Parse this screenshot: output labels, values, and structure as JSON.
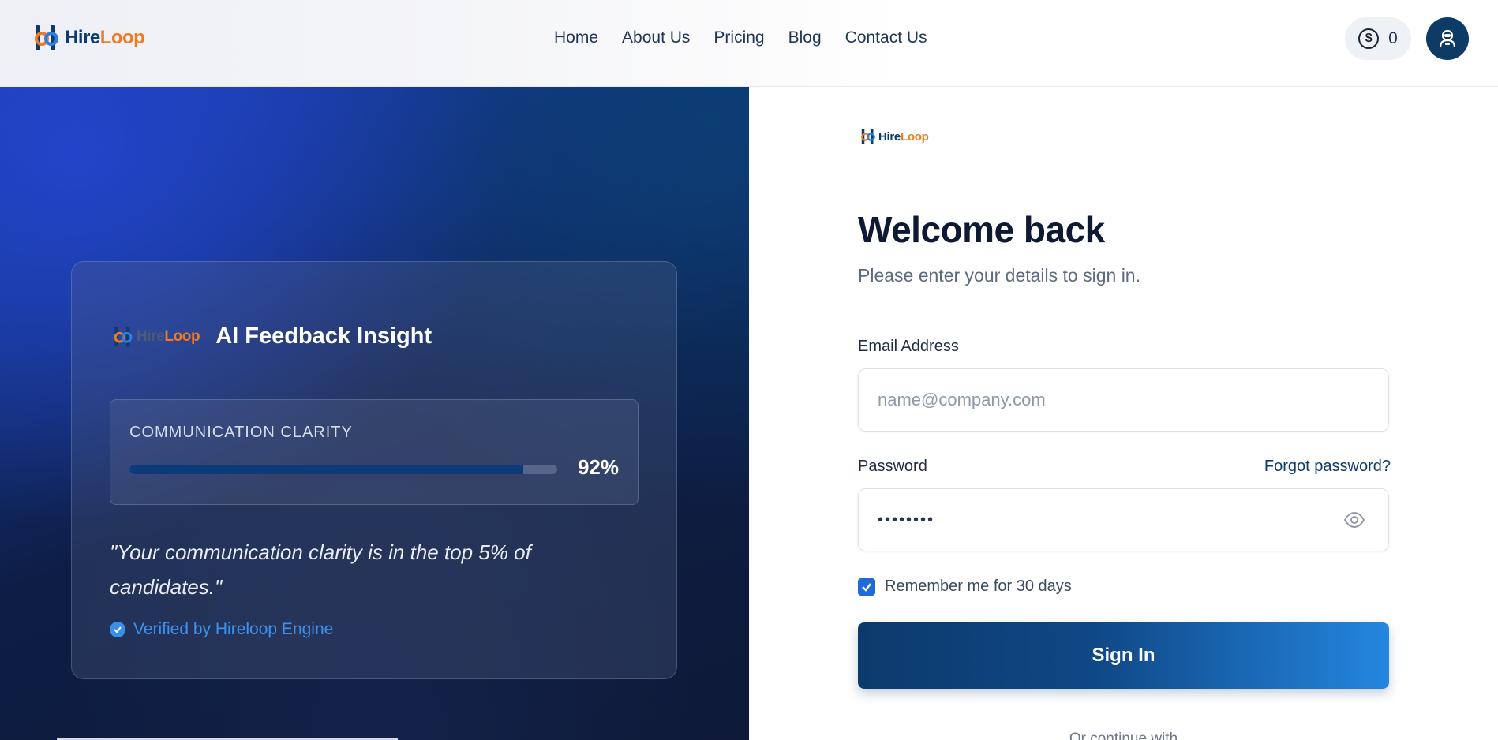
{
  "brand": {
    "hire": "Hire",
    "loop": "Loop",
    "accent_orange": "#ef7a20",
    "accent_navy": "#0e3b6e"
  },
  "nav": {
    "items": [
      "Home",
      "About Us",
      "Pricing",
      "Blog",
      "Contact Us"
    ]
  },
  "credits": {
    "icon": "dollar-coin-icon",
    "count": "0"
  },
  "profile": {
    "icon": "user-avatar-icon"
  },
  "insight": {
    "card_brand_hire": "Hire",
    "card_brand_loop": "Loop",
    "title": "AI Feedback Insight",
    "metric_label": "COMMUNICATION CLARITY",
    "metric_value": "92%",
    "metric_fraction": 0.92,
    "quote": "\"Your communication clarity is in the top 5% of candidates.\"",
    "verified": "Verified by Hireloop Engine"
  },
  "form": {
    "logo_hire": "Hire",
    "logo_loop": "Loop",
    "heading": "Welcome back",
    "subtitle": "Please enter your details to sign in.",
    "email_label": "Email Address",
    "email_placeholder": "name@company.com",
    "email_value": "",
    "password_label": "Password",
    "forgot_label": "Forgot password?",
    "password_value": "••••••••",
    "remember_label": "Remember me for 30 days",
    "remember_checked": true,
    "signin_label": "Sign In",
    "continue_label": "Or continue with"
  }
}
